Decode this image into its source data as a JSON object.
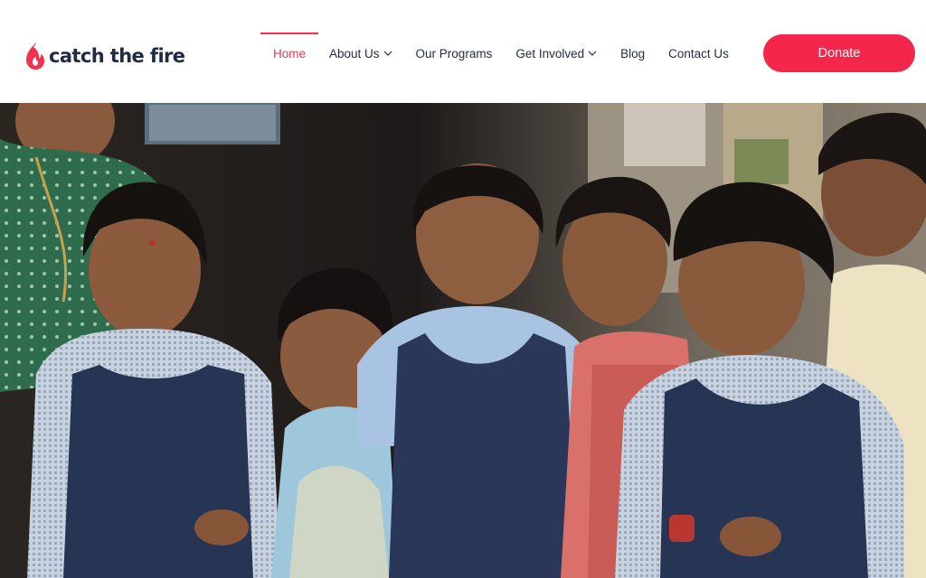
{
  "header": {
    "logo_text": "catch the fire",
    "logo_icon": "flame-icon",
    "nav": [
      {
        "label": "Home",
        "active": true,
        "dropdown": false
      },
      {
        "label": "About Us",
        "active": false,
        "dropdown": true
      },
      {
        "label": "Our Programs",
        "active": false,
        "dropdown": false
      },
      {
        "label": "Get Involved",
        "active": false,
        "dropdown": true
      },
      {
        "label": "Blog",
        "active": false,
        "dropdown": false
      },
      {
        "label": "Contact Us",
        "active": false,
        "dropdown": false
      }
    ],
    "donate_label": "Donate"
  },
  "colors": {
    "accent": "#f0324f",
    "donate_bg": "#f5264b",
    "nav_text": "#1f2a44",
    "logo_text": "#1f2a44"
  },
  "hero": {
    "image": "photo-smiling-children-in-school-uniforms"
  }
}
